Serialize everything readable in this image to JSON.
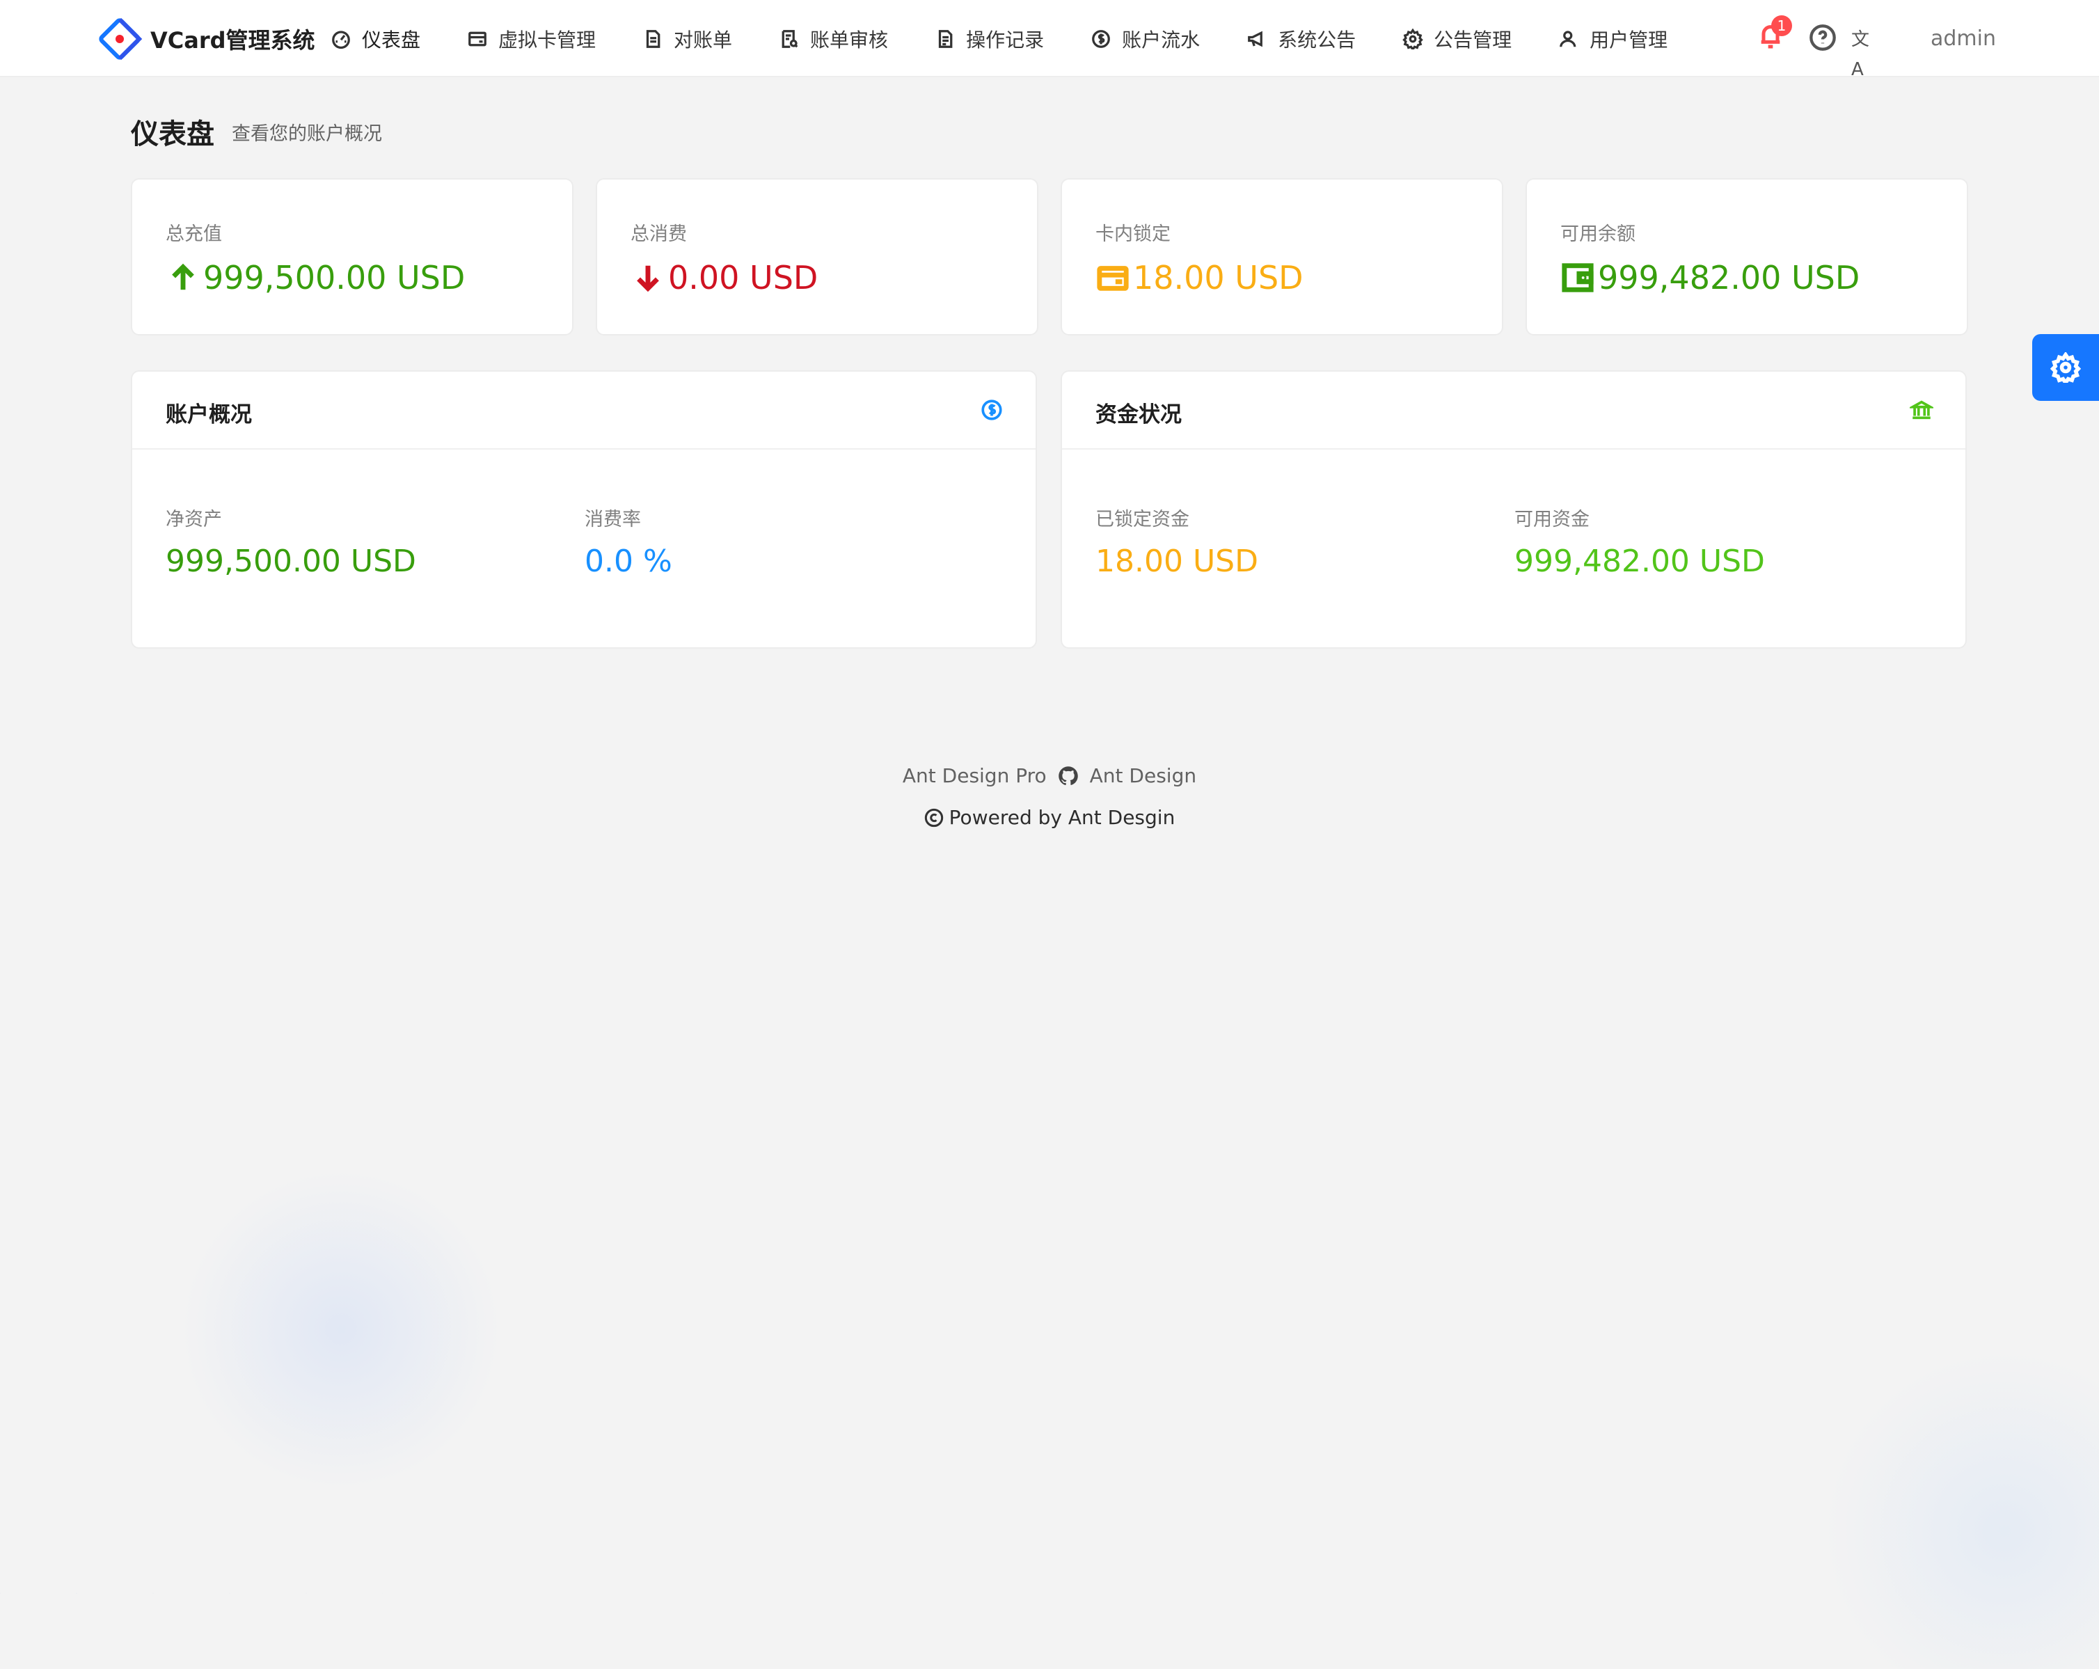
{
  "app": {
    "title": "VCard管理系统"
  },
  "nav": {
    "items": [
      {
        "label": "仪表盘",
        "icon": "dashboard-icon"
      },
      {
        "label": "虚拟卡管理",
        "icon": "card-icon"
      },
      {
        "label": "对账单",
        "icon": "document-icon"
      },
      {
        "label": "账单审核",
        "icon": "audit-icon"
      },
      {
        "label": "操作记录",
        "icon": "log-icon"
      },
      {
        "label": "账户流水",
        "icon": "dollar-circle-icon"
      },
      {
        "label": "系统公告",
        "icon": "megaphone-icon"
      },
      {
        "label": "公告管理",
        "icon": "gear-icon"
      },
      {
        "label": "用户管理",
        "icon": "user-icon"
      }
    ],
    "active": "仪表盘"
  },
  "header": {
    "notification_count": "1",
    "lang_glyph": "文A",
    "user": "admin"
  },
  "page": {
    "title": "仪表盘",
    "subtitle": "查看您的账户概况"
  },
  "stats": [
    {
      "label": "总充值",
      "value": "999,500.00 USD",
      "color": "#389e0d",
      "icon": "arrow-up-icon"
    },
    {
      "label": "总消费",
      "value": "0.00 USD",
      "color": "#cf1322",
      "icon": "arrow-down-icon"
    },
    {
      "label": "卡内锁定",
      "value": "18.00 USD",
      "color": "#faad14",
      "icon": "credit-card-icon"
    },
    {
      "label": "可用余额",
      "value": "999,482.00 USD",
      "color": "#389e0d",
      "icon": "wallet-icon"
    }
  ],
  "panels": {
    "account": {
      "title": "账户概况",
      "icon": "dollar-circle-icon",
      "metrics": [
        {
          "label": "净资产",
          "value": "999,500.00 USD",
          "color": "#389e0d"
        },
        {
          "label": "消费率",
          "value": "0.0 %",
          "color": "#1890ff"
        }
      ]
    },
    "funds": {
      "title": "资金状况",
      "icon": "bank-icon",
      "metrics": [
        {
          "label": "已锁定资金",
          "value": "18.00 USD",
          "color": "#faad14"
        },
        {
          "label": "可用资金",
          "value": "999,482.00 USD",
          "color": "#52c41a"
        }
      ]
    }
  },
  "footer": {
    "link1": "Ant Design Pro",
    "link2": "Ant Design",
    "copyright": "Powered by Ant Desgin"
  },
  "colors": {
    "primary": "#1677ff",
    "danger": "#ff4d4f"
  }
}
